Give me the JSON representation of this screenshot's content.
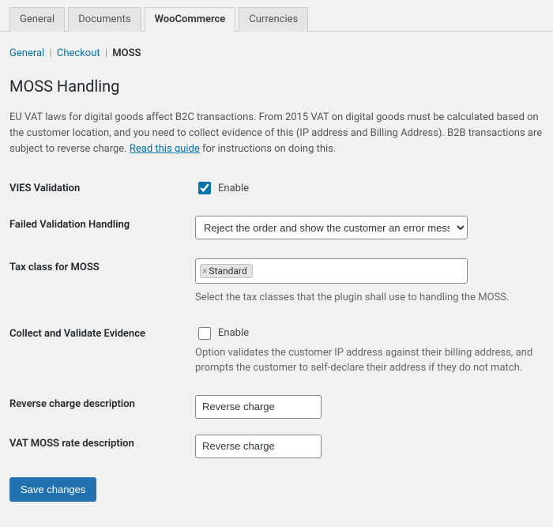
{
  "tabs": [
    "General",
    "Documents",
    "WooCommerce",
    "Currencies"
  ],
  "tabs_active_index": 2,
  "subnav": {
    "items": [
      "General",
      "Checkout",
      "MOSS"
    ],
    "active_index": 2
  },
  "heading": "MOSS Handling",
  "intro_prefix": "EU VAT laws for digital goods affect B2C transactions. From 2015 VAT on digital goods must be calculated based on the customer location, and you need to collect evidence of this (IP address and Billing Address). B2B transactions are subject to reverse charge. ",
  "intro_link": "Read this guide",
  "intro_suffix": " for instructions on doing this.",
  "fields": {
    "vies": {
      "label": "VIES Validation",
      "enable": "Enable",
      "checked": true
    },
    "failed": {
      "label": "Failed Validation Handling",
      "selected": "Reject the order and show the customer an error message."
    },
    "taxclass": {
      "label": "Tax class for MOSS",
      "tags": [
        "Standard"
      ],
      "help": "Select the tax classes that the plugin shall use to handling the MOSS."
    },
    "collect": {
      "label": "Collect and Validate Evidence",
      "enable": "Enable",
      "checked": false,
      "help": "Option validates the customer IP address against their billing address, and prompts the customer to self-declare their address if they do not match."
    },
    "reverse_desc": {
      "label": "Reverse charge description",
      "value": "Reverse charge"
    },
    "moss_rate_desc": {
      "label": "VAT MOSS rate description",
      "value": "Reverse charge"
    }
  },
  "save_label": "Save changes"
}
